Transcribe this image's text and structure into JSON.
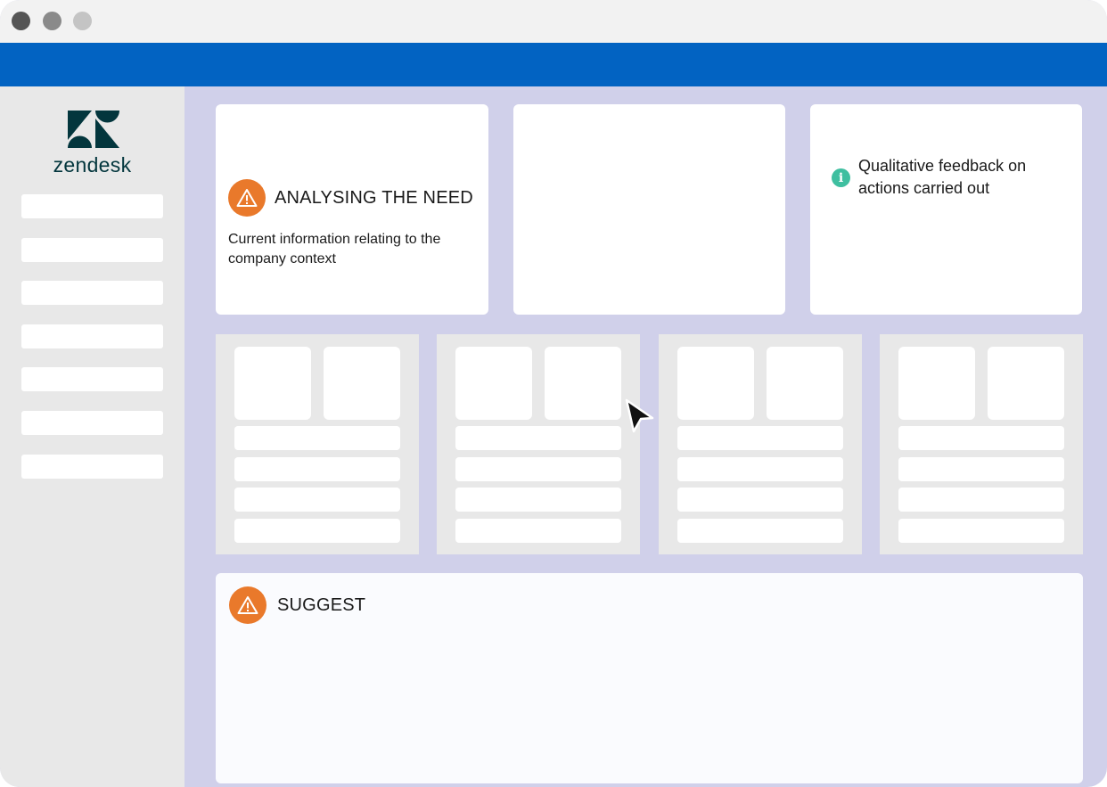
{
  "window": {
    "controls": [
      "close-dot",
      "minimize-dot",
      "zoom-dot"
    ]
  },
  "sidebar": {
    "logo_text": "zendesk",
    "item_count_visible": 7
  },
  "cards": {
    "analysing": {
      "icon": "warning-icon",
      "title": "ANALYSING THE NEED",
      "body": "Current information relating to the company context"
    },
    "feedback": {
      "icon": "info-icon",
      "info_glyph": "i",
      "text": "Qualitative feedback on actions carried out"
    }
  },
  "suggest": {
    "icon": "warning-icon",
    "title": "SUGGEST"
  },
  "colors": {
    "topbar": "#0263c2",
    "content_bg": "#d0d0ea",
    "sidebar_bg": "#e8e8e8",
    "warning": "#e9792b",
    "info": "#3fbfa0",
    "brand": "#03363d"
  }
}
